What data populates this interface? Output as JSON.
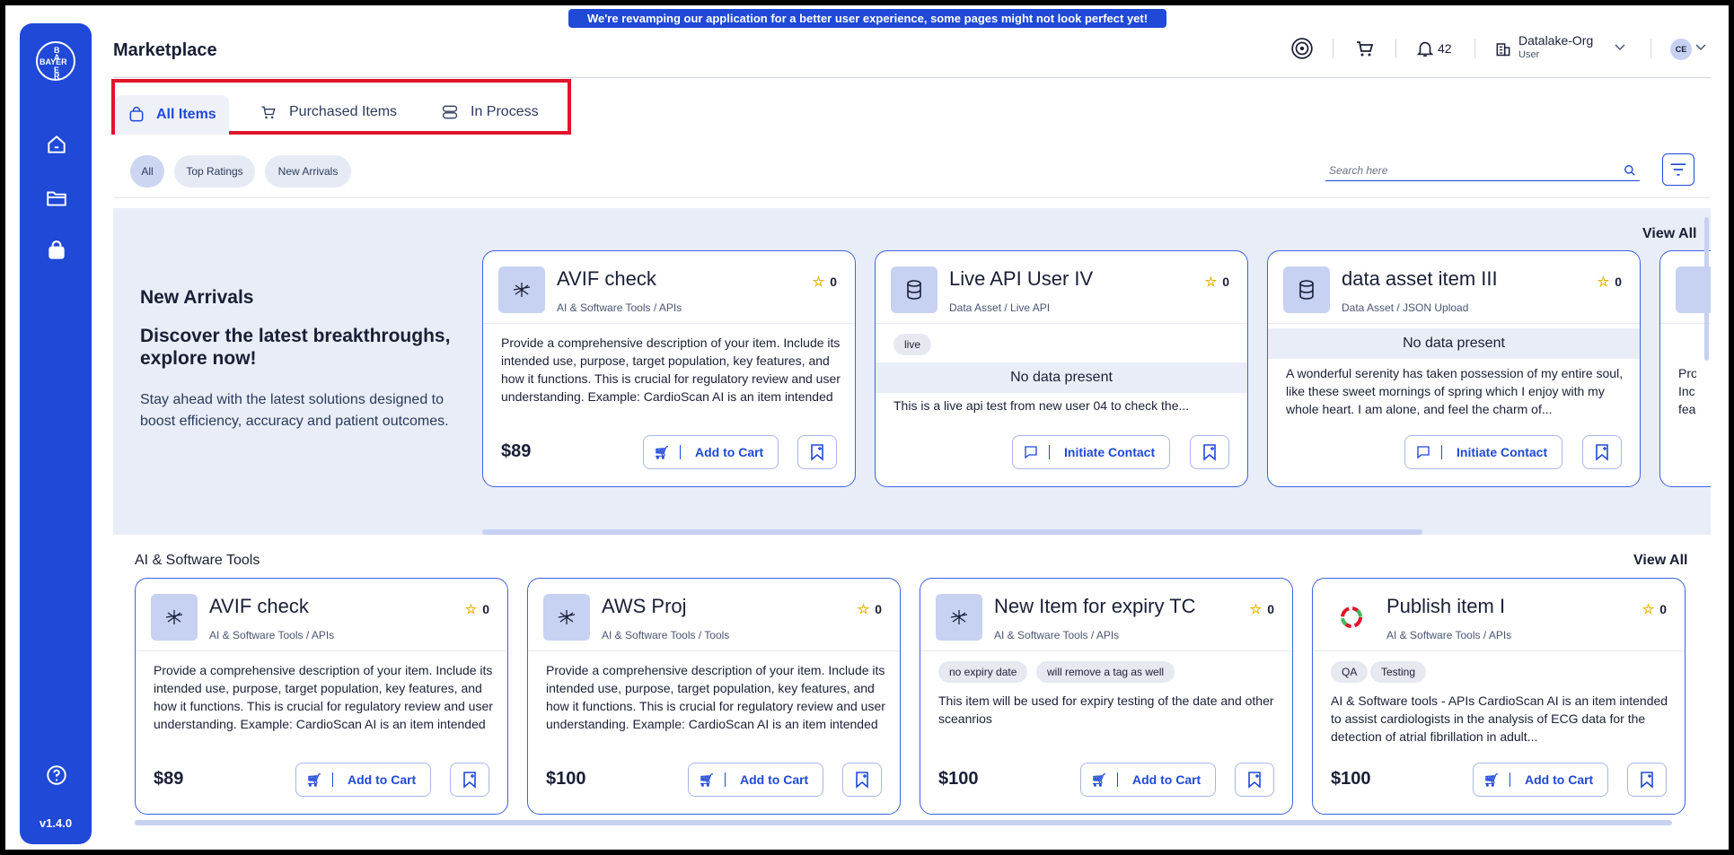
{
  "banner": "We're revamping our application for a better user experience, some pages might not look perfect yet!",
  "page_title": "Marketplace",
  "version": "v1.4.0",
  "logo_text": "BAYER",
  "header": {
    "notifications_count": "42",
    "org_name": "Datalake-Org",
    "org_role": "User",
    "avatar_initials": "CE"
  },
  "tabs": [
    {
      "label": "All Items"
    },
    {
      "label": "Purchased Items"
    },
    {
      "label": "In Process"
    }
  ],
  "filters": [
    {
      "label": "All"
    },
    {
      "label": "Top Ratings"
    },
    {
      "label": "New Arrivals"
    }
  ],
  "search": {
    "placeholder": "Search here"
  },
  "new_arrivals": {
    "heading": "New Arrivals",
    "subheading": "Discover the latest breakthroughs, explore now!",
    "description": "Stay ahead with the latest solutions designed to boost efficiency, accuracy and patient outcomes.",
    "view_all": "View All",
    "cards": [
      {
        "title": "AVIF check",
        "category": "AI & Software Tools / APIs",
        "rating": "0",
        "description": "Provide a comprehensive description of your item. Include its intended use, purpose, target population, key features, and how it functions. This is crucial for regulatory review and user understanding. Example: CardioScan AI is an item intended to assist cardiologist...",
        "price": "$89",
        "action": "Add to Cart"
      },
      {
        "title": "Live API User IV",
        "category": "Data Asset / Live API",
        "rating": "0",
        "tag": "live",
        "no_data": "No data present",
        "description": "This is a live api test from new user 04 to check the...",
        "action": "Initiate Contact"
      },
      {
        "title": "data asset item III",
        "category": "Data Asset / JSON Upload",
        "rating": "0",
        "no_data": "No data present",
        "description": "A wonderful serenity has taken possession of my entire soul, like these sweet mornings of spring which I enjoy with my whole heart. I am alone, and feel the charm of...",
        "action": "Initiate Contact"
      },
      {
        "partial_text": "Pro Inc fea"
      }
    ]
  },
  "ai_tools": {
    "heading": "AI & Software Tools",
    "view_all": "View All",
    "cards": [
      {
        "title": "AVIF check",
        "category": "AI & Software Tools / APIs",
        "rating": "0",
        "description": "Provide a comprehensive description of your item. Include its intended use, purpose, target population, key features, and how it functions. This is crucial for regulatory review and user understanding. Example: CardioScan AI is an item intended to assist cardiologist...",
        "price": "$89",
        "action": "Add to Cart"
      },
      {
        "title": "AWS Proj",
        "category": "AI & Software Tools / Tools",
        "rating": "0",
        "description": "Provide a comprehensive description of your item. Include its intended use, purpose, target population, key features, and how it functions. This is crucial for regulatory review and user understanding. Example: CardioScan AI is an item intended to assist cardiologist...",
        "price": "$100",
        "action": "Add to Cart"
      },
      {
        "title": "New Item for expiry TC",
        "category": "AI & Software Tools / APIs",
        "rating": "0",
        "tags": [
          "no expiry date",
          "will remove a tag as well"
        ],
        "description": "This item will be used for expiry testing of the date and other sceanrios",
        "price": "$100",
        "action": "Add to Cart"
      },
      {
        "title": "Publish item I",
        "category": "AI & Software Tools / APIs",
        "rating": "0",
        "tags": [
          "QA",
          "Testing"
        ],
        "description": "AI & Software tools - APIs CardioScan AI is an item intended to assist cardiologists in the analysis of ECG data for the detection of atrial fibrillation in adult...",
        "price": "$100",
        "action": "Add to Cart"
      }
    ]
  },
  "colors": {
    "primary": "#1f49d6",
    "highlight": "#e1142b",
    "star": "#e9b404"
  }
}
